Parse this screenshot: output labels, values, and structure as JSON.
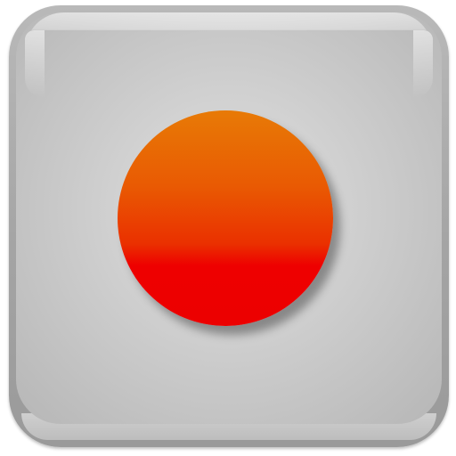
{
  "record_button": {
    "icon": "record-icon",
    "face_color": "#d2d2d2",
    "rim_color": "#a4a4a4",
    "dot_color_top": "#e87a06",
    "dot_color_bottom": "#ee0000"
  }
}
